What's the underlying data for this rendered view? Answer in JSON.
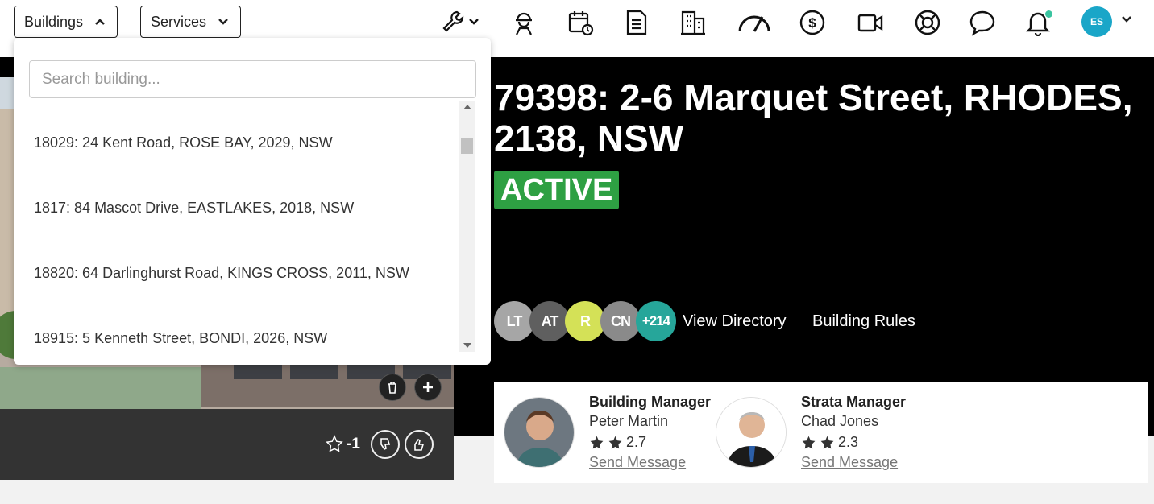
{
  "nav": {
    "buildings_label": "Buildings",
    "services_label": "Services",
    "user_initials": "ES"
  },
  "icons": [
    "wrench-icon",
    "worker-icon",
    "calendar-clock-icon",
    "document-icon",
    "building-icon",
    "gauge-icon",
    "dollar-icon",
    "video-icon",
    "lifebuoy-icon",
    "chat-icon",
    "bell-icon"
  ],
  "dropdown": {
    "search_placeholder": "Search building...",
    "items": [
      {
        "label": "18029: 24 Kent Road, ROSE BAY, 2029, NSW"
      },
      {
        "label": "1817: 84 Mascot Drive, EASTLAKES, 2018, NSW"
      },
      {
        "label": "18820: 64 Darlinghurst Road, KINGS CROSS, 2011, NSW"
      },
      {
        "label": "18915: 5 Kenneth Street, BONDI, 2026, NSW"
      }
    ]
  },
  "building": {
    "title": "79398: 2-6 Marquet Street, RHODES, 2138, NSW",
    "status": "ACTIVE",
    "rating": "-1"
  },
  "directory": {
    "avatars": [
      {
        "initials": "LT",
        "color": "#a6a6a6"
      },
      {
        "initials": "AT",
        "color": "#5f5f5f"
      },
      {
        "initials": "R",
        "color": "#d4e157"
      },
      {
        "initials": "CN",
        "color": "#8a8a8a"
      },
      {
        "initials": "+214",
        "color": "#26a69a"
      }
    ],
    "view_directory_label": "View Directory",
    "building_rules_label": "Building Rules"
  },
  "managers": [
    {
      "role": "Building Manager",
      "name": "Peter Martin",
      "rating": "2.7",
      "message_label": "Send Message"
    },
    {
      "role": "Strata Manager",
      "name": "Chad Jones",
      "rating": "2.3",
      "message_label": "Send Message"
    }
  ],
  "colors": {
    "active_green": "#2ea043",
    "accent_teal": "#26a69a",
    "avatar_blue": "#1aa6c8"
  }
}
